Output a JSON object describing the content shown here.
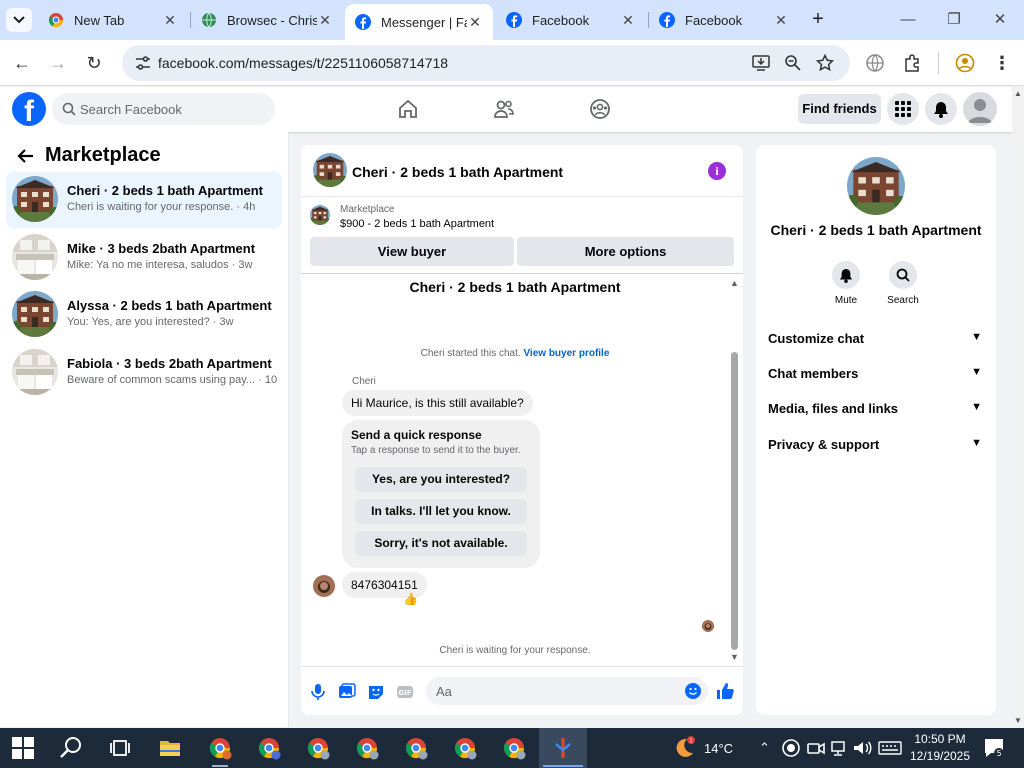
{
  "browser": {
    "tabs": [
      {
        "title": "New Tab",
        "favicon": "chrome-icon"
      },
      {
        "title": "Browsec - Chris",
        "favicon": "browsec-globe-icon"
      },
      {
        "title": "Messenger | Fa",
        "favicon": "facebook-icon",
        "active": true
      },
      {
        "title": "Facebook",
        "favicon": "facebook-icon"
      },
      {
        "title": "Facebook",
        "favicon": "facebook-icon"
      }
    ],
    "url": "facebook.com/messages/t/2251106058714718"
  },
  "header": {
    "search_placeholder": "Search Facebook",
    "find_friends": "Find friends"
  },
  "sidebar": {
    "title": "Marketplace",
    "chats": [
      {
        "name": "Cheri · 2 beds 1 bath Apartment",
        "preview": "Cheri is waiting for your response. · 4h",
        "thumb": "building"
      },
      {
        "name": "Mike · 3 beds 2bath Apartment",
        "preview": "Mike: Ya no me interesa, saludos · 3w",
        "thumb": "kitchen"
      },
      {
        "name": "Alyssa · 2 beds 1 bath Apartment",
        "preview": "You: Yes, are you interested? · 3w",
        "thumb": "building"
      },
      {
        "name": "Fabiola · 3 beds 2bath Apartment",
        "preview": "Beware of common scams using pay... · 10w",
        "thumb": "kitchen"
      }
    ]
  },
  "conversation": {
    "title": "Cheri · 2 beds 1 bath Apartment",
    "marketplace_label": "Marketplace",
    "listing": "$900 - 2 beds 1 bath Apartment",
    "view_buyer": "View buyer",
    "more_options": "More options",
    "scroll_title": "Cheri · 2 beds 1 bath Apartment",
    "started_text": "Cheri started this chat.",
    "view_profile": "View buyer profile",
    "sender": "Cheri",
    "message_1": "Hi Maurice, is this still available?",
    "quick_title": "Send a quick response",
    "quick_sub": "Tap a response to send it to the buyer.",
    "quick_options": [
      "Yes, are you interested?",
      "In talks. I'll let you know.",
      "Sorry, it's not available."
    ],
    "message_2": "8476304151",
    "reaction": "👍",
    "waiting": "Cheri is waiting for your response.",
    "composer_placeholder": "Aa"
  },
  "info_panel": {
    "title": "Cheri · 2 beds 1 bath Apartment",
    "actions": [
      {
        "label": "Mute",
        "icon": "bell-icon"
      },
      {
        "label": "Search",
        "icon": "search-icon"
      }
    ],
    "sections": [
      "Customize chat",
      "Chat members",
      "Media, files and links",
      "Privacy & support"
    ]
  },
  "taskbar": {
    "temperature": "14°C",
    "time": "10:50 PM",
    "date": "12/19/2025",
    "notification_count": "5",
    "weather_badge": "1"
  },
  "colors": {
    "fb_blue": "#0866ff",
    "info_purple": "#9b2fd9",
    "link_blue": "#0064d1"
  }
}
